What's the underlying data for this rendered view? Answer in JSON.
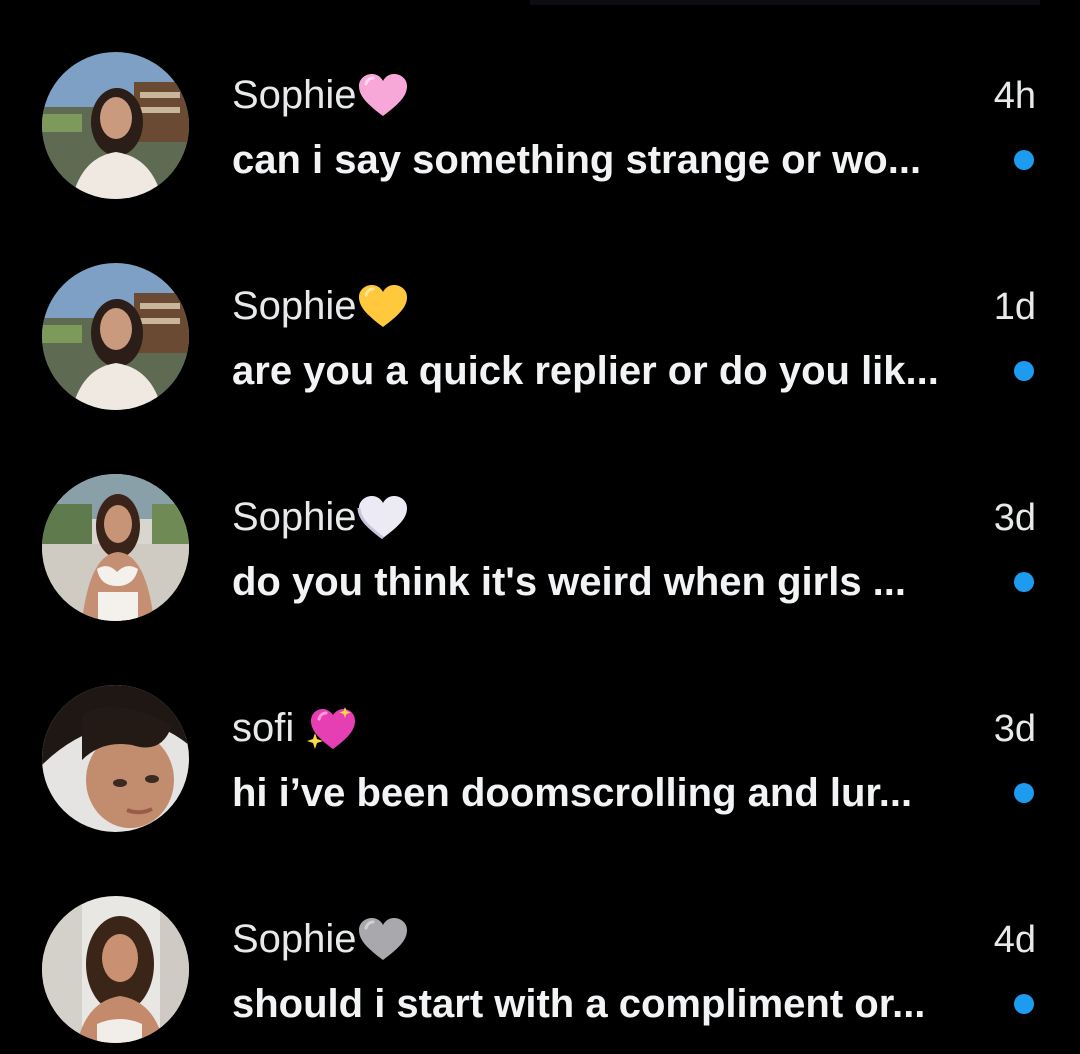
{
  "colors": {
    "background": "#000000",
    "text": "#e7e9ea",
    "unread_dot": "#1d9bf0"
  },
  "threads": [
    {
      "name": "Sophie",
      "heart_icon": "pink-heart-icon",
      "heart_color": "#f7a8d8",
      "time": "4h",
      "preview": "can i say something strange or wo...",
      "unread": true
    },
    {
      "name": "Sophie",
      "heart_icon": "yellow-heart-icon",
      "heart_color": "#ffc83d",
      "time": "1d",
      "preview": "are you a quick replier or do you lik...",
      "unread": true
    },
    {
      "name": "Sophie",
      "heart_icon": "white-heart-icon",
      "heart_color": "#eceaf4",
      "time": "3d",
      "preview": "do you think it's weird when girls ...",
      "unread": true
    },
    {
      "name": "sofi ",
      "heart_icon": "sparkling-heart-icon",
      "heart_color": "#e63fb3",
      "time": "3d",
      "preview": "hi i’ve been doomscrolling and lur...",
      "unread": true
    },
    {
      "name": "Sophie",
      "heart_icon": "grey-heart-icon",
      "heart_color": "#a8a8ad",
      "time": "4d",
      "preview": "should i start with a compliment or...",
      "unread": true
    }
  ]
}
